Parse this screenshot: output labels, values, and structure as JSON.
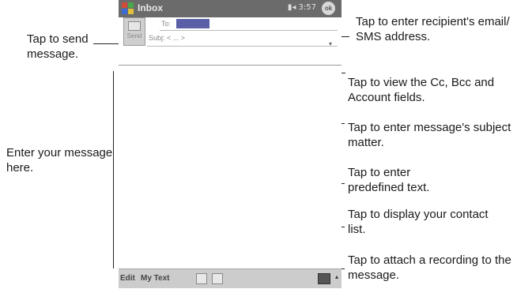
{
  "device": {
    "title": "Inbox",
    "status": "3:57",
    "ok_label": "ok",
    "send_label": "Send",
    "to_label": "To:",
    "to_value": "",
    "subject_label": "Subj:",
    "subject_value": "< ... >",
    "expand_symbol": "▾",
    "menu": {
      "edit": "Edit",
      "my_text": "My Text",
      "kbd_arrow": "▴"
    }
  },
  "callouts": {
    "send": "Tap to send message.",
    "recipient": "Tap to enter recipient's email/ SMS address.",
    "cc_bcc": "Tap to view the Cc, Bcc and Account fields.",
    "subject": "Tap to enter message's subject matter.",
    "body": "Enter your message here.",
    "predefined": "Tap to enter predefined text.",
    "contacts": "Tap to display your contact list.",
    "recording": "Tap to attach a recording to the message."
  }
}
